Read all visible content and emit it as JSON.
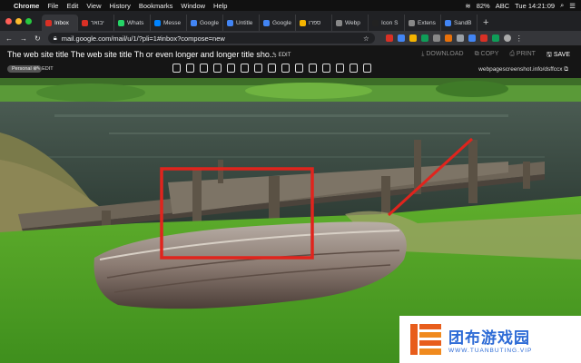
{
  "menubar": {
    "app": "Chrome",
    "items": [
      "File",
      "Edit",
      "View",
      "History",
      "Bookmarks",
      "Window",
      "Help"
    ],
    "battery": "82%",
    "input": "ABC",
    "clock": "Tue 14:21:09"
  },
  "tabs": [
    {
      "label": "Inbox",
      "color": "#d93025",
      "active": true
    },
    {
      "label": "יבואר",
      "color": "#d93025"
    },
    {
      "label": "Whats",
      "color": "#25d366"
    },
    {
      "label": "Messe",
      "color": "#0084ff"
    },
    {
      "label": "Google",
      "color": "#4285f4"
    },
    {
      "label": "Untitle",
      "color": "#4285f4"
    },
    {
      "label": "Google",
      "color": "#4285f4"
    },
    {
      "label": "ספרו",
      "color": "#f4b400"
    },
    {
      "label": "Webp",
      "color": "#888888"
    },
    {
      "label": "Icon S",
      "color": "#222222"
    },
    {
      "label": "Extens",
      "color": "#888888"
    },
    {
      "label": "SandB",
      "color": "#4285f4"
    }
  ],
  "address": {
    "url": "mail.google.com/mail/u/1/?pli=1#inbox?compose=new"
  },
  "overlay": {
    "title": "The web site title The web site title Th or even longer and longer title sho...",
    "edit_label": "EDIT",
    "badge": "Personal",
    "edit2_label": "EDIT",
    "download": "DOWNLOAD",
    "copy": "COPY",
    "print": "PRINT",
    "save": "SAVE",
    "domain": "webpagescreenshot.info/dsffccx"
  },
  "watermark": {
    "name": "团布游戏园",
    "url": "WWW.TUANBUTING.VIP"
  },
  "colors": {
    "annotation": "#e0241d",
    "watermark": "#2d6bd6"
  }
}
